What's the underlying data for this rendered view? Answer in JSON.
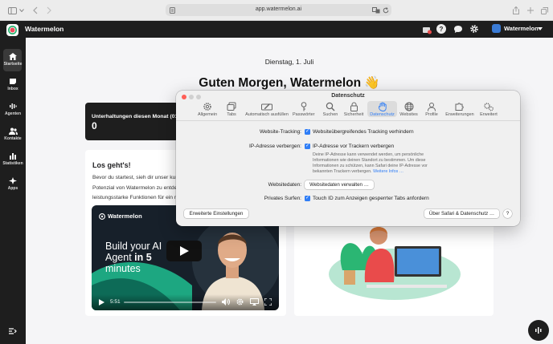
{
  "browser": {
    "url": "app.watermelon.ai"
  },
  "app": {
    "name": "Watermelon",
    "account": "Watermelon"
  },
  "sidebar": {
    "items": [
      {
        "label": "Startseite",
        "icon": "home-icon"
      },
      {
        "label": "Inbox",
        "icon": "inbox-icon"
      },
      {
        "label": "Agenten",
        "icon": "agents-icon"
      },
      {
        "label": "Kontakte",
        "icon": "contacts-icon"
      },
      {
        "label": "Statistiken",
        "icon": "stats-icon"
      },
      {
        "label": "Apps",
        "icon": "apps-icon"
      }
    ]
  },
  "main": {
    "date": "Dienstag, 1. Juli",
    "greeting": "Guten Morgen, Watermelon 👋",
    "stats": {
      "label": "Unterhaltungen diesen Monat",
      "label_suffix": "(01-0",
      "value": "0"
    },
    "getting_started": {
      "title": "Los geht's!",
      "text_line1": "Bevor du startest, sieh dir unser kur",
      "text_line2": "Potenzial von Watermelon zu entde",
      "text_line3": "leistungsstarke Funktionen für ein n"
    },
    "video": {
      "brand": "Watermelon",
      "headline_1": "Build your AI",
      "headline_2": "Agent",
      "headline_3": "in 5",
      "headline_4": "minutes",
      "time": "5:51",
      "progress": 0.0
    }
  },
  "dialog": {
    "title": "Datenschutz",
    "toolbar": [
      "Allgemein",
      "Tabs",
      "Automatisch ausfüllen",
      "Passwörter",
      "Suchen",
      "Sicherheit",
      "Datenschutz",
      "Websites",
      "Profile",
      "Erweiterungen",
      "Erweitert"
    ],
    "active_tab": "Datenschutz",
    "tracking_label": "Website-Tracking:",
    "tracking_option": "Websiteübergreifendes Tracking verhindern",
    "ip_label": "IP-Adresse verbergen:",
    "ip_option": "IP-Adresse vor Trackern verbergen",
    "ip_desc_1": "Deine IP-Adresse kann verwendet werden, um persönliche",
    "ip_desc_2": "Informationen wie deinen Standort zu bestimmen. Um diese",
    "ip_desc_3": "Informationen zu schützen, kann Safari deine IP-Adresse vor",
    "ip_desc_4": "bekannten Trackern verbergen.",
    "more_info": "Weitere Infos …",
    "websitedata_label": "Websitedaten:",
    "websitedata_button": "Websitedaten verwalten …",
    "private_label": "Privates Surfen:",
    "private_option": "Touch ID zum Anzeigen gesperrter Tabs anfordern",
    "advanced_button": "Erweiterte Einstellungen",
    "about_button": "Über Safari & Datenschutz …",
    "help_button": "?"
  },
  "colors": {
    "accent": "#2f7df6",
    "brand_green": "#2bb673",
    "dark": "#1e1e1e"
  }
}
